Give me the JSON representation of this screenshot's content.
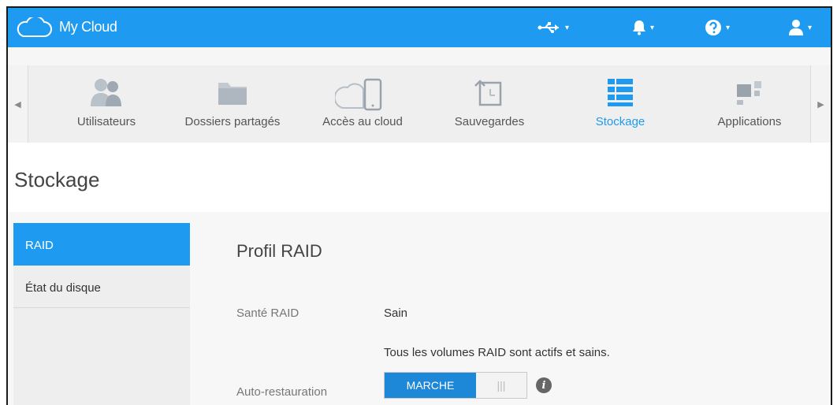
{
  "header": {
    "brand": "My Cloud",
    "icons": [
      "usb-icon",
      "bell-icon",
      "help-icon",
      "user-icon"
    ],
    "caret": "▾",
    "accent_color": "#1e9bf0"
  },
  "nav": {
    "left_arrow": "◀",
    "right_arrow": "▶",
    "items": [
      {
        "label": "Utilisateurs",
        "icon": "users-icon"
      },
      {
        "label": "Dossiers partagés",
        "icon": "folder-icon"
      },
      {
        "label": "Accès au cloud",
        "icon": "cloud-device-icon"
      },
      {
        "label": "Sauvegardes",
        "icon": "backup-icon"
      },
      {
        "label": "Stockage",
        "icon": "storage-icon",
        "active": true
      },
      {
        "label": "Applications",
        "icon": "apps-icon"
      }
    ]
  },
  "page": {
    "title": "Stockage"
  },
  "sidebar": {
    "items": [
      {
        "label": "RAID",
        "active": true
      },
      {
        "label": "État du disque"
      }
    ]
  },
  "raid": {
    "section_title": "Profil RAID",
    "health_label": "Santé RAID",
    "health_value": "Sain",
    "health_detail": "Tous les volumes RAID sont actifs et sains.",
    "auto_restore_label": "Auto-restauration",
    "toggle_on": "MARCHE",
    "toggle_off": "|||",
    "info_glyph": "i"
  }
}
